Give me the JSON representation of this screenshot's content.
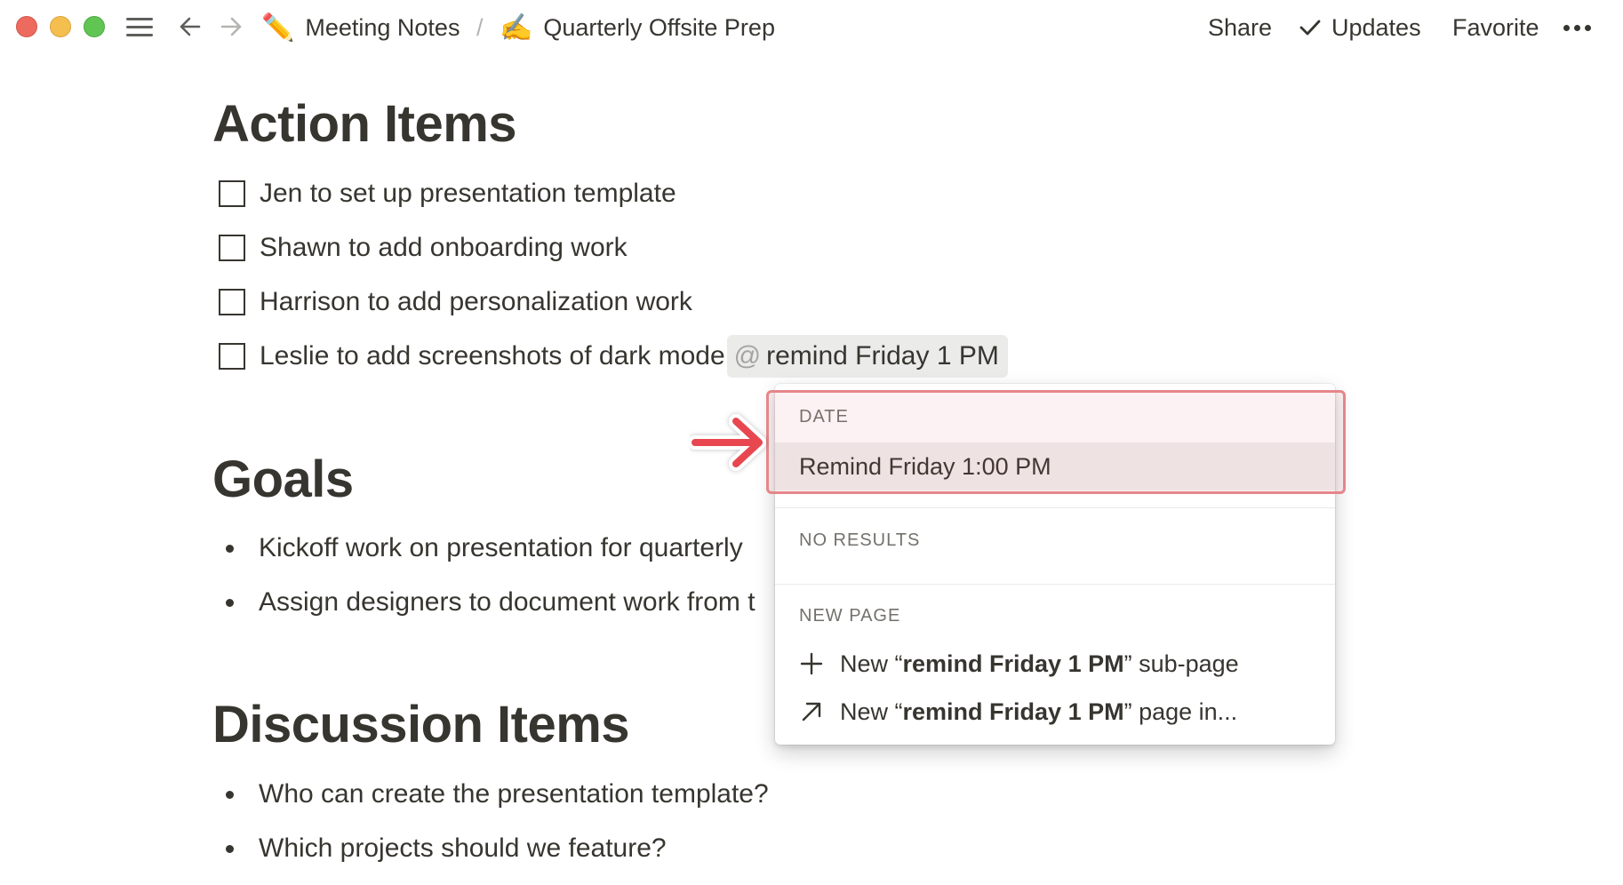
{
  "window": {
    "traffic_lights": {
      "close": "#ed6a5e",
      "minimize": "#f5bf4f",
      "maximize": "#61c554"
    }
  },
  "topbar": {
    "breadcrumb": [
      {
        "icon": "pencil-emoji",
        "emoji": "✏️",
        "label": "Meeting Notes"
      },
      {
        "icon": "writing-hand-emoji",
        "emoji": "✍️",
        "label": "Quarterly Offsite Prep"
      }
    ],
    "separator": "/",
    "actions": {
      "share": "Share",
      "updates": "Updates",
      "favorite": "Favorite"
    }
  },
  "page": {
    "action_items": {
      "heading": "Action Items",
      "todos": [
        {
          "text": "Jen to set up presentation template",
          "checked": false
        },
        {
          "text": "Shawn to add onboarding work",
          "checked": false
        },
        {
          "text": "Harrison to add personalization work",
          "checked": false
        },
        {
          "text": "Leslie to add screenshots of dark mode",
          "checked": false,
          "mention_at": "@",
          "mention_text": "remind Friday 1 PM"
        }
      ]
    },
    "goals": {
      "heading": "Goals",
      "bullets": [
        "Kickoff work on presentation for quarterly",
        "Assign designers to document work from t"
      ]
    },
    "discussion_items": {
      "heading": "Discussion Items",
      "bullets": [
        "Who can create the presentation template?",
        "Which projects should we feature?"
      ]
    }
  },
  "mention_popup": {
    "date_label": "DATE",
    "date_option": "Remind Friday 1:00 PM",
    "no_results_label": "NO RESULTS",
    "new_page_label": "NEW PAGE",
    "new_subpage": {
      "prefix": "New “",
      "query": "remind Friday 1 PM",
      "suffix": "” sub-page"
    },
    "new_page_in": {
      "prefix": "New “",
      "query": "remind Friday 1 PM",
      "suffix": "” page in..."
    }
  },
  "annotation": {
    "highlight_color": "#e5868b",
    "arrow_color": "#e8474f"
  }
}
